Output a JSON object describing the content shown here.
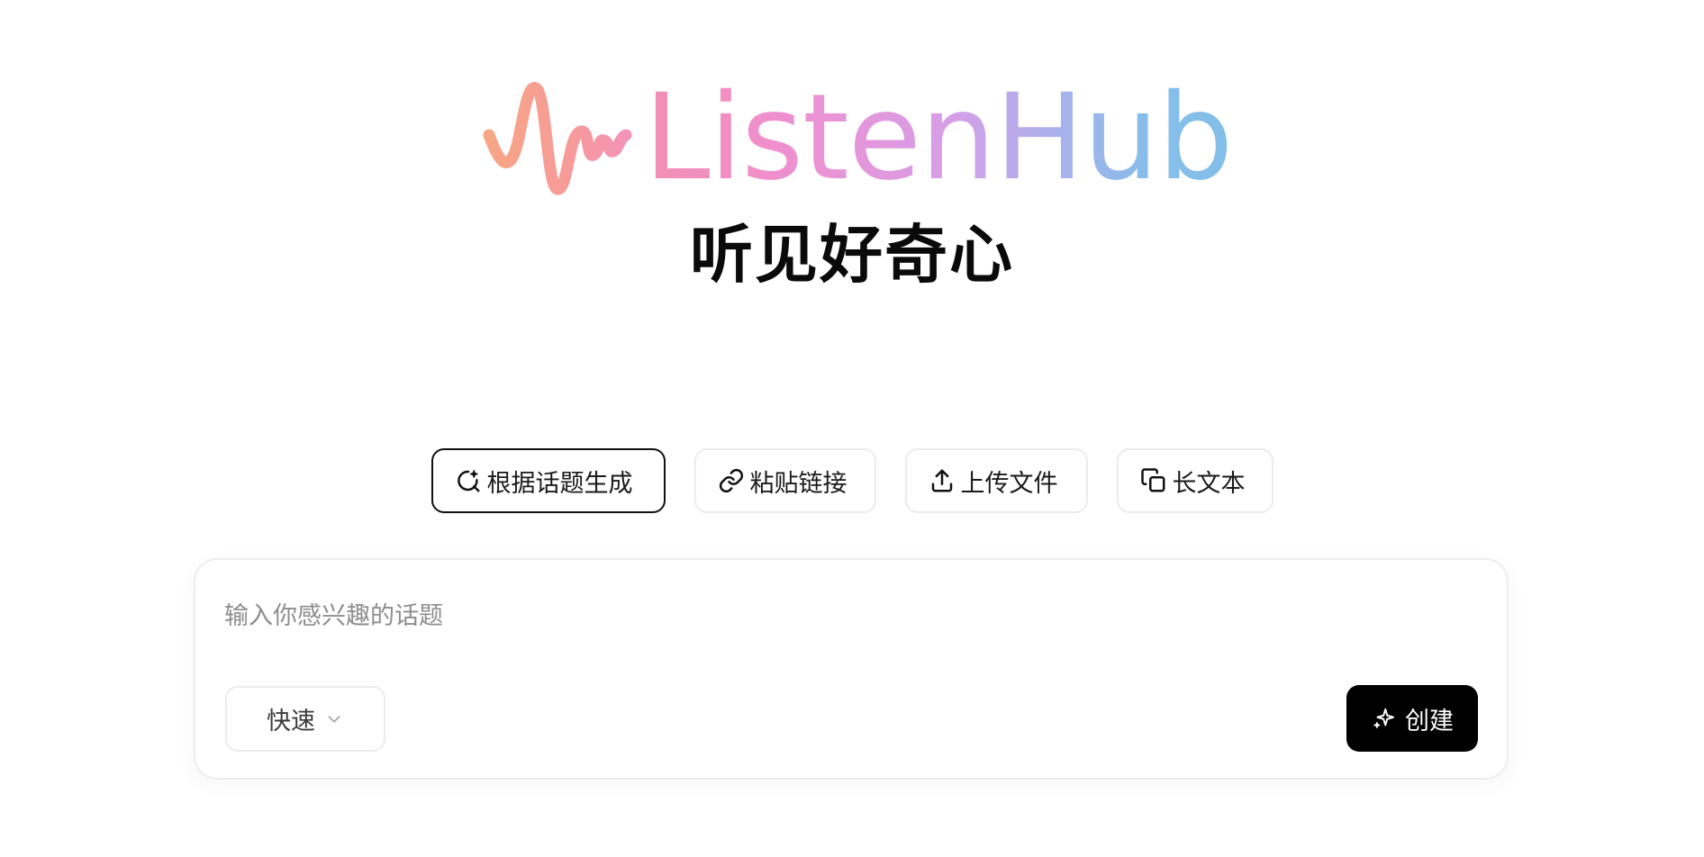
{
  "brand": {
    "name": "ListenHub",
    "tagline": "听见好奇心"
  },
  "modes": [
    {
      "label": "根据话题生成",
      "icon": "search-sparkle-icon",
      "active": true
    },
    {
      "label": "粘贴链接",
      "icon": "link-icon",
      "active": false
    },
    {
      "label": "上传文件",
      "icon": "upload-icon",
      "active": false
    },
    {
      "label": "长文本",
      "icon": "copy-icon",
      "active": false
    }
  ],
  "composer": {
    "placeholder": "输入你感兴趣的话题",
    "speed_label": "快速",
    "create_label": "创建"
  },
  "colors": {
    "logo_gradient_start": "#f7a08f",
    "logo_gradient_mid": "#d79ee8",
    "logo_gradient_end": "#82bfe8",
    "active_border": "#111111",
    "create_bg": "#000000"
  }
}
